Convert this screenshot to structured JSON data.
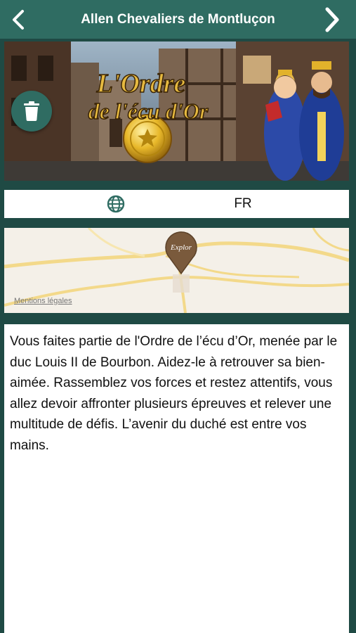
{
  "navbar": {
    "title": "Allen Chevaliers de Montluçon",
    "back_icon": "chevron-left-icon",
    "next_icon": "chevron-right-icon"
  },
  "hero": {
    "logo_line1": "L'Ordre",
    "logo_line2": "de l'écu d'Or",
    "delete_icon": "trash-icon"
  },
  "language": {
    "icon": "globe-icon",
    "label": "FR"
  },
  "map": {
    "legal_link": "Mentions légales",
    "pin_label": "Explor"
  },
  "description": {
    "text": "Vous faites partie de l'Ordre de l’écu d’Or, menée par le duc Louis II de Bourbon. Aidez-le à retrouver sa bien-aimée. Rassemblez vos forces et restez attentifs, vous allez devoir affronter plusieurs épreuves et relever une multitude de défis. L’avenir du duché est entre vos mains."
  },
  "colors": {
    "navbar": "#2f6c62",
    "background": "#1f4a44",
    "accent": "#2f6c62"
  }
}
